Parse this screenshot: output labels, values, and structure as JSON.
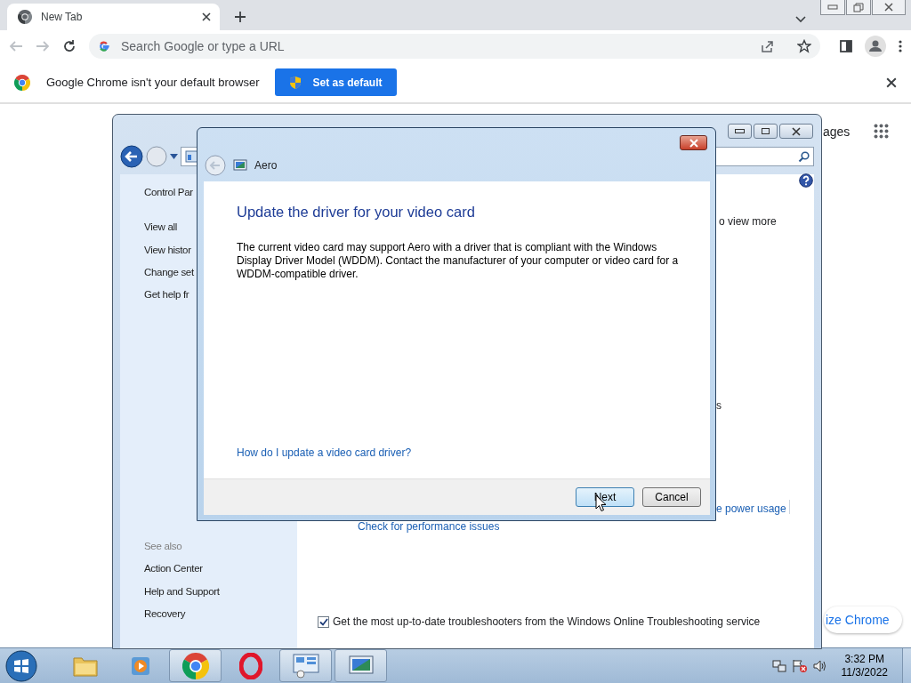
{
  "browser": {
    "tab": {
      "title": "New Tab"
    },
    "omnibox": {
      "placeholder": "Search Google or type a URL"
    },
    "infobar": {
      "message": "Google Chrome isn't your default browser",
      "button": "Set as default"
    },
    "new_tab_page": {
      "images_link": "ages",
      "customize_button": "ize Chrome"
    }
  },
  "troubleshooting_window": {
    "sidebar": {
      "items": [
        "Control Par",
        "View all",
        "View histor",
        "Change set",
        "Get help fr"
      ],
      "see_also_heading": "See also",
      "see_also": [
        "Action Center",
        "Help and Support",
        "Recovery"
      ]
    },
    "fragments": [
      {
        "text": "o view more",
        "kind": "plain"
      },
      {
        "text": "s",
        "kind": "plain"
      },
      {
        "text": "e power usage",
        "kind": "link"
      }
    ],
    "performance_link": "Check for performance issues",
    "online_option": {
      "label": "Get the most up-to-date troubleshooters from the Windows Online Troubleshooting service",
      "checked": true
    }
  },
  "dialog": {
    "title": "Aero",
    "heading": "Update the driver for your video card",
    "body": "The current video card may support Aero with a driver that is compliant with the Windows Display Driver Model (WDDM).  Contact the manufacturer of your computer or video card for a WDDM-compatible driver.",
    "link": "How do I update a video card driver?",
    "buttons": [
      {
        "label": "Next",
        "kind": "default"
      },
      {
        "label": "Cancel",
        "kind": "normal"
      }
    ]
  },
  "taskbar": {
    "apps": [
      {
        "kind": "folder",
        "running": false
      },
      {
        "kind": "media",
        "running": false
      },
      {
        "kind": "chrome",
        "running": true
      },
      {
        "kind": "opera",
        "running": false
      },
      {
        "kind": "control-panel",
        "running": true
      },
      {
        "kind": "display",
        "running": true
      }
    ],
    "time": "3:32 PM",
    "date": "11/3/2022"
  }
}
